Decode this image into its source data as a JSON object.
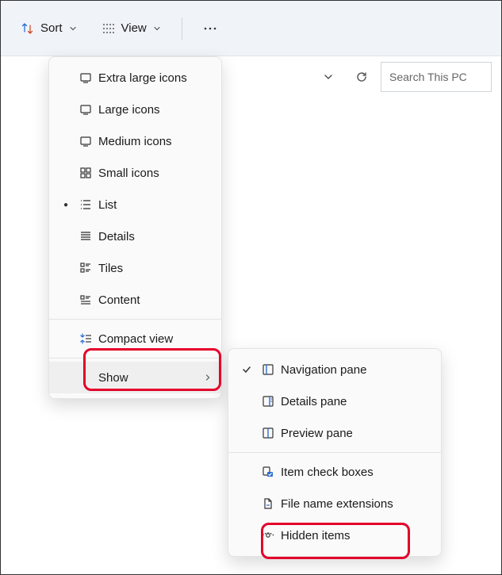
{
  "toolbar": {
    "sort_label": "Sort",
    "view_label": "View"
  },
  "search": {
    "placeholder": "Search This PC"
  },
  "view_menu": {
    "items": [
      {
        "label": "Extra large icons",
        "icon": "monitor-icon"
      },
      {
        "label": "Large icons",
        "icon": "monitor-icon"
      },
      {
        "label": "Medium icons",
        "icon": "monitor-icon"
      },
      {
        "label": "Small icons",
        "icon": "grid4-icon"
      },
      {
        "label": "List",
        "icon": "list-icon",
        "selected": true
      },
      {
        "label": "Details",
        "icon": "details-icon"
      },
      {
        "label": "Tiles",
        "icon": "tiles-icon"
      },
      {
        "label": "Content",
        "icon": "content-icon"
      }
    ],
    "compact_label": "Compact view",
    "show_label": "Show"
  },
  "show_menu": {
    "items": [
      {
        "label": "Navigation pane",
        "icon": "nav-pane-icon",
        "checked": true
      },
      {
        "label": "Details pane",
        "icon": "details-pane-icon"
      },
      {
        "label": "Preview pane",
        "icon": "preview-pane-icon"
      }
    ],
    "items2": [
      {
        "label": "Item check boxes",
        "icon": "checkboxes-icon"
      },
      {
        "label": "File name extensions",
        "icon": "file-ext-icon"
      },
      {
        "label": "Hidden items",
        "icon": "hidden-icon"
      }
    ]
  }
}
